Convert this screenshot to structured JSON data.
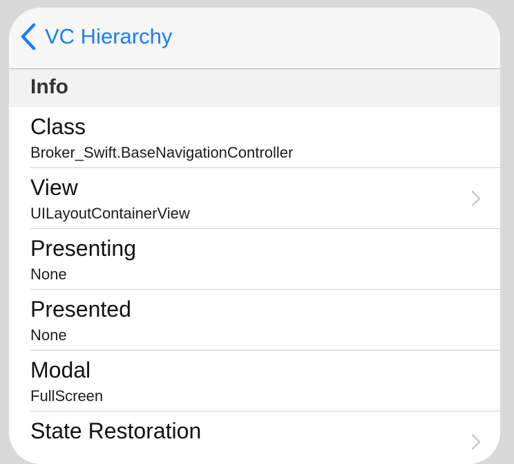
{
  "navbar": {
    "back_label": "VC Hierarchy"
  },
  "section": {
    "title": "Info"
  },
  "rows": [
    {
      "title": "Class",
      "value": "Broker_Swift.BaseNavigationController",
      "has_disclosure": false
    },
    {
      "title": "View",
      "value": "UILayoutContainerView",
      "has_disclosure": true
    },
    {
      "title": "Presenting",
      "value": "None",
      "has_disclosure": false
    },
    {
      "title": "Presented",
      "value": "None",
      "has_disclosure": false
    },
    {
      "title": "Modal",
      "value": "FullScreen",
      "has_disclosure": false
    },
    {
      "title": "State Restoration",
      "value": "",
      "has_disclosure": true
    }
  ],
  "colors": {
    "accent": "#1a7cf5",
    "chevron": "#c7c7cc"
  },
  "icons": {
    "back": "chevron-left-icon",
    "disclosure": "chevron-right-icon"
  }
}
